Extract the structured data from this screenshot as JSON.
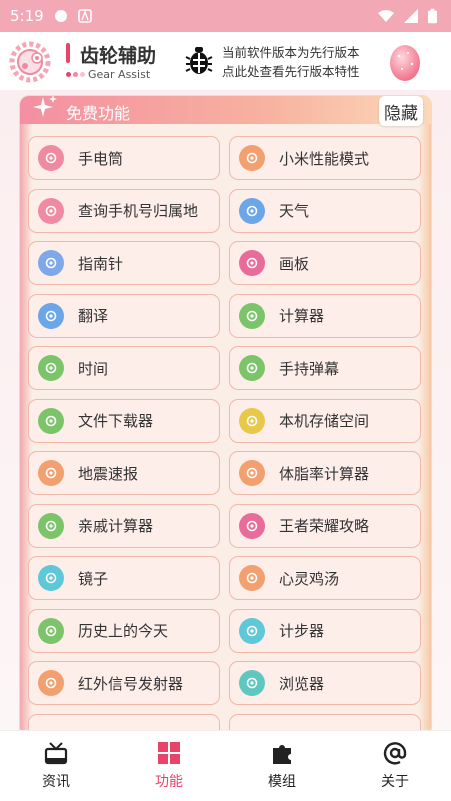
{
  "status_bar": {
    "time": "5:19"
  },
  "header": {
    "title": "齿轮辅助",
    "subtitle": "Gear Assist",
    "notice_line1": "当前软件版本为先行版本",
    "notice_line2": "点此处查看先行版本特性"
  },
  "section": {
    "title": "免费功能",
    "hide_label": "隐藏"
  },
  "features": [
    {
      "label": "手电筒",
      "icon": "flashlight-icon",
      "color": "#f08aa0"
    },
    {
      "label": "小米性能模式",
      "icon": "mi-performance-icon",
      "color": "#f2a070"
    },
    {
      "label": "查询手机号归属地",
      "icon": "phone-location-icon",
      "color": "#f08aa0"
    },
    {
      "label": "天气",
      "icon": "weather-icon",
      "color": "#6aa6e8"
    },
    {
      "label": "指南针",
      "icon": "compass-icon",
      "color": "#7fa8e8"
    },
    {
      "label": "画板",
      "icon": "palette-icon",
      "color": "#e96b9a"
    },
    {
      "label": "翻译",
      "icon": "translate-icon",
      "color": "#6aa6e8"
    },
    {
      "label": "计算器",
      "icon": "calculator-icon",
      "color": "#7cc46a"
    },
    {
      "label": "时间",
      "icon": "clock-icon",
      "color": "#7cc46a"
    },
    {
      "label": "手持弹幕",
      "icon": "barrage-icon",
      "color": "#7cc46a"
    },
    {
      "label": "文件下载器",
      "icon": "download-icon",
      "color": "#7cc46a"
    },
    {
      "label": "本机存储空间",
      "icon": "storage-icon",
      "color": "#e8c84a"
    },
    {
      "label": "地震速报",
      "icon": "home-alert-icon",
      "color": "#f2a070"
    },
    {
      "label": "体脂率计算器",
      "icon": "body-fat-icon",
      "color": "#f2a070"
    },
    {
      "label": "亲戚计算器",
      "icon": "relatives-icon",
      "color": "#7cc46a"
    },
    {
      "label": "王者荣耀攻略",
      "icon": "game-guide-icon",
      "color": "#e96b9a"
    },
    {
      "label": "镜子",
      "icon": "mirror-icon",
      "color": "#5ec8d8"
    },
    {
      "label": "心灵鸡汤",
      "icon": "soup-icon",
      "color": "#f2a070"
    },
    {
      "label": "历史上的今天",
      "icon": "history-icon",
      "color": "#7cc46a"
    },
    {
      "label": "计步器",
      "icon": "pedometer-icon",
      "color": "#5ec8d8"
    },
    {
      "label": "红外信号发射器",
      "icon": "infrared-icon",
      "color": "#f2a070"
    },
    {
      "label": "浏览器",
      "icon": "browser-icon",
      "color": "#5ec8c0"
    }
  ],
  "bottom_nav": [
    {
      "label": "资讯",
      "icon": "news-icon"
    },
    {
      "label": "功能",
      "icon": "grid-icon",
      "active": true
    },
    {
      "label": "模组",
      "icon": "puzzle-icon"
    },
    {
      "label": "关于",
      "icon": "at-icon"
    }
  ]
}
